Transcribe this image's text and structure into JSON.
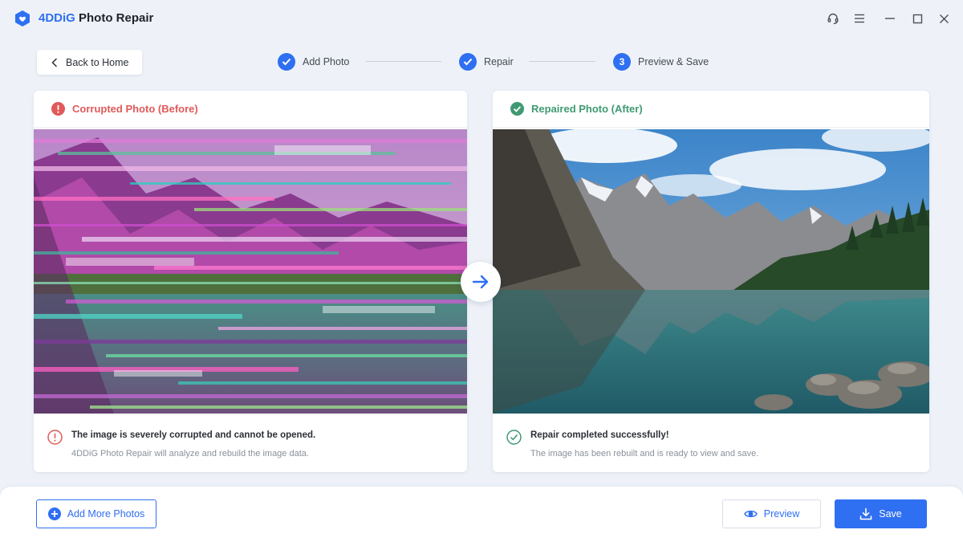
{
  "app": {
    "brand": "4DDiG",
    "name": " Photo Repair"
  },
  "navigation": {
    "back_label": "Back to Home"
  },
  "steps": [
    {
      "label": "Add Photo",
      "state": "done"
    },
    {
      "label": "Repair",
      "state": "done"
    },
    {
      "number": "3",
      "label": "Preview & Save",
      "state": "current"
    }
  ],
  "before_panel": {
    "title": "Corrupted Photo (Before)",
    "message_title": "The image is severely corrupted and cannot be opened.",
    "message_body": "4DDiG Photo Repair will analyze and rebuild the image data."
  },
  "after_panel": {
    "title": "Repaired Photo (After)",
    "message_title": "Repair completed successfully!",
    "message_body": "The image has been rebuilt and is ready to view and save."
  },
  "actions": {
    "add_more_label": "Add More Photos",
    "preview_label": "Preview",
    "save_label": "Save"
  },
  "colors": {
    "accent": "#2f6ff2",
    "error": "#e05a5a",
    "success": "#3f9a72"
  }
}
